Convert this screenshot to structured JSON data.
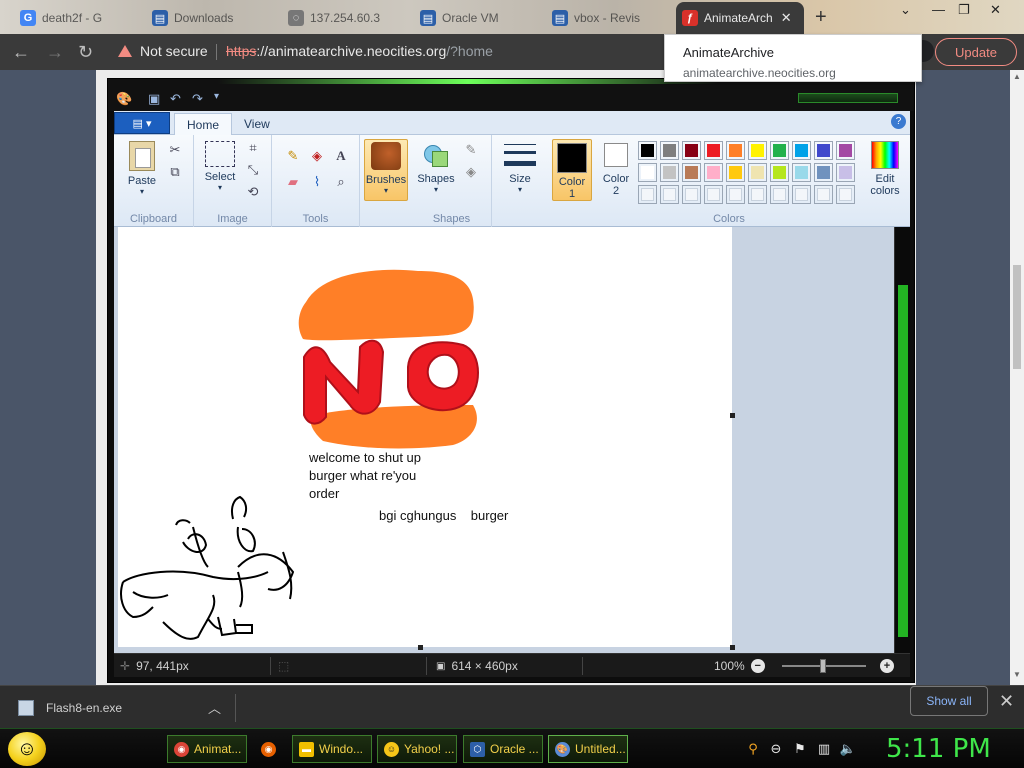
{
  "browser": {
    "tabs": [
      {
        "label": "death2f - G",
        "icon": "google-icon",
        "color": "#4285f4",
        "glyph": "G"
      },
      {
        "label": "Downloads",
        "icon": "downloads-icon",
        "color": "#2c5fa8",
        "glyph": "▤"
      },
      {
        "label": "137.254.60.3",
        "icon": "globe-icon",
        "color": "#777777",
        "glyph": "◌"
      },
      {
        "label": "Oracle VM",
        "icon": "oracle-icon",
        "color": "#2c5fa8",
        "glyph": "▤"
      },
      {
        "label": "vbox - Revis",
        "icon": "vbox-icon",
        "color": "#2c5fa8",
        "glyph": "▤"
      },
      {
        "label": "AnimateArch",
        "icon": "flash-icon",
        "color": "#d9312a",
        "glyph": "ƒ"
      }
    ],
    "address": {
      "security": "Not secure",
      "scheme": "https",
      "host": "://animatearchive.neocities.org",
      "path": "/?home"
    },
    "update_label": "Update",
    "tooltip": {
      "title": "AnimateArchive",
      "url": "animatearchive.neocities.org"
    }
  },
  "paint": {
    "tabs": [
      "Home",
      "View"
    ],
    "groups": {
      "clipboard": {
        "name": "Clipboard",
        "paste": "Paste"
      },
      "image": {
        "name": "Image",
        "select": "Select"
      },
      "tools": {
        "name": "Tools"
      },
      "brushes": "Brushes",
      "shapes": {
        "name": "Shapes",
        "label": "Shapes"
      },
      "size": "Size",
      "colors": {
        "name": "Colors",
        "color1": "Color\n1",
        "color2": "Color\n2",
        "edit": "Edit colors"
      }
    },
    "palette": [
      [
        "#000000",
        "#7f7f7f",
        "#880015",
        "#ed1c24",
        "#ff7f27",
        "#fff200",
        "#22b14c",
        "#00a2e8",
        "#3f48cc",
        "#a349a4"
      ],
      [
        "#ffffff",
        "#c3c3c3",
        "#b97a57",
        "#ffaec9",
        "#ffc90e",
        "#efe4b0",
        "#b5e61d",
        "#99d9ea",
        "#7092be",
        "#c8bfe7"
      ],
      [
        "",
        "",
        "",
        "",
        "",
        "",
        "",
        "",
        "",
        ""
      ]
    ],
    "canvas_text": {
      "line1": "welcome to shut up",
      "line2": "burger what re'you",
      "line3": "order",
      "line4": "bgi cghungus    burger"
    },
    "status": {
      "cursor": "97, 441px",
      "size": "614 × 460px",
      "zoom": "100%"
    }
  },
  "downloads": {
    "file": "Flash8-en.exe",
    "show_all": "Show all"
  },
  "taskbar": {
    "items": [
      {
        "label": "Animat...",
        "icon": "chrome-icon",
        "color": "#db4437"
      },
      {
        "label": "",
        "icon": "firefox-icon",
        "color": "#e66000"
      },
      {
        "label": "Windo...",
        "icon": "folder-icon",
        "color": "#f0c000"
      },
      {
        "label": "Yahoo! ...",
        "icon": "yahoo-icon",
        "color": "#f5c518"
      },
      {
        "label": "Oracle ...",
        "icon": "virtualbox-icon",
        "color": "#2d5fa8"
      },
      {
        "label": "Untitled...",
        "icon": "paint-icon",
        "color": "#5a8bd6"
      }
    ],
    "clock": "5:11 PM"
  }
}
